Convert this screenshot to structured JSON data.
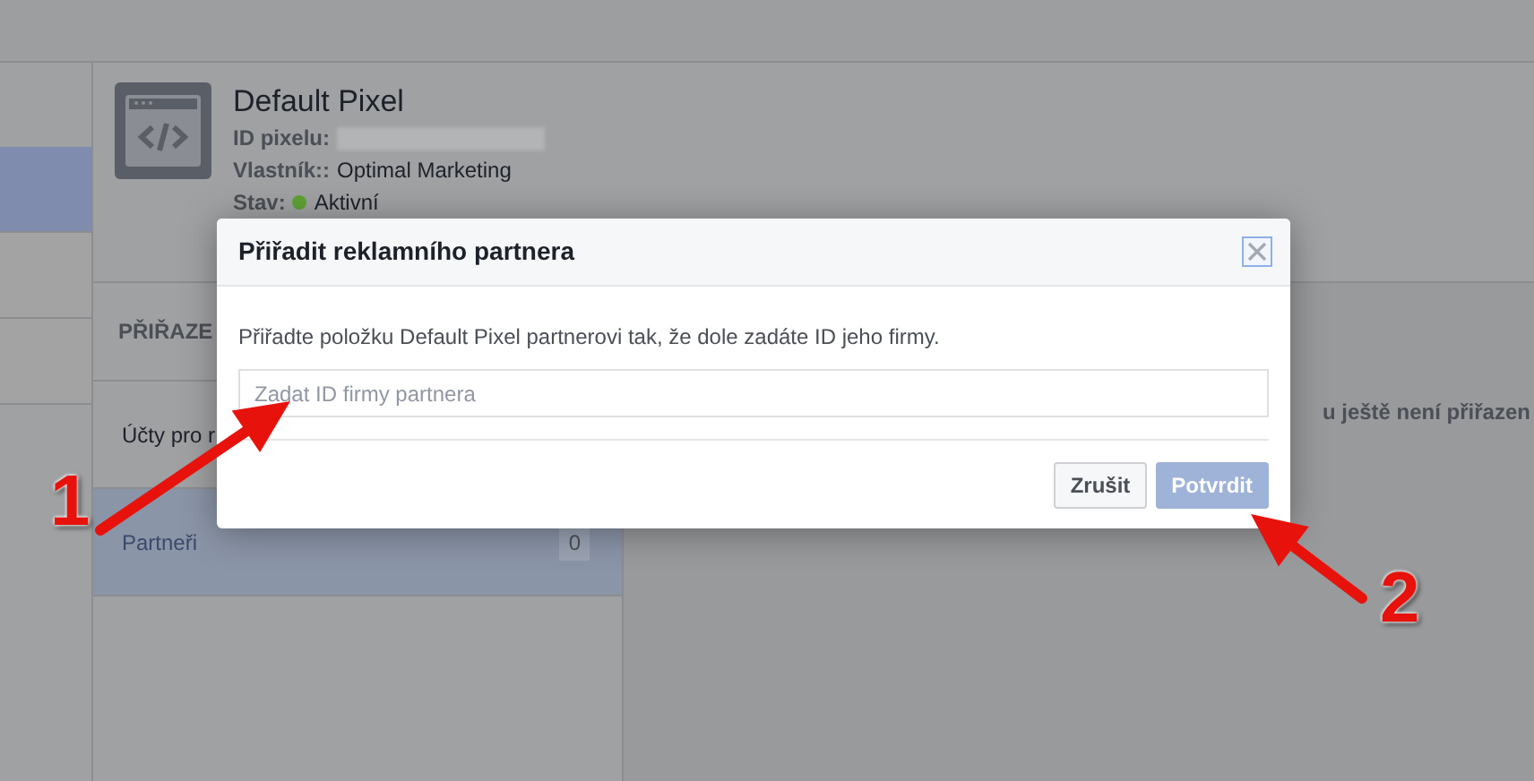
{
  "sidebar": {
    "items": [
      {
        "selected": true
      },
      {
        "selected": false
      },
      {
        "selected": false
      }
    ]
  },
  "pixel": {
    "title": "Default Pixel",
    "fields": [
      {
        "label": "ID pixelu:",
        "kind": "redacted"
      },
      {
        "label": "Vlastník::",
        "value": "Optimal Marketing",
        "kind": "text"
      },
      {
        "label": "Stav:",
        "value": "Aktivní",
        "kind": "status",
        "color": "#5fa135"
      }
    ]
  },
  "assignments": {
    "header": "PŘIŘAZE",
    "items": [
      {
        "label": "Účty pro r",
        "selected": false
      },
      {
        "label": "Partneři",
        "count": "0",
        "selected": true
      }
    ]
  },
  "content": {
    "message": "u ještě není přiřazen"
  },
  "dialog": {
    "title": "Přiřadit reklamního partnera",
    "text": "Přiřadte položku Default Pixel partnerovi tak, že dole zadáte ID jeho firmy.",
    "input": {
      "placeholder": "Zadat ID firmy partnera"
    },
    "buttons": [
      {
        "label": "Zrušit",
        "kind": "secondary",
        "disabled": false
      },
      {
        "label": "Potvrdit",
        "kind": "primary",
        "disabled": true
      }
    ]
  },
  "annotations": [
    {
      "label": "1"
    },
    {
      "label": "2"
    }
  ]
}
